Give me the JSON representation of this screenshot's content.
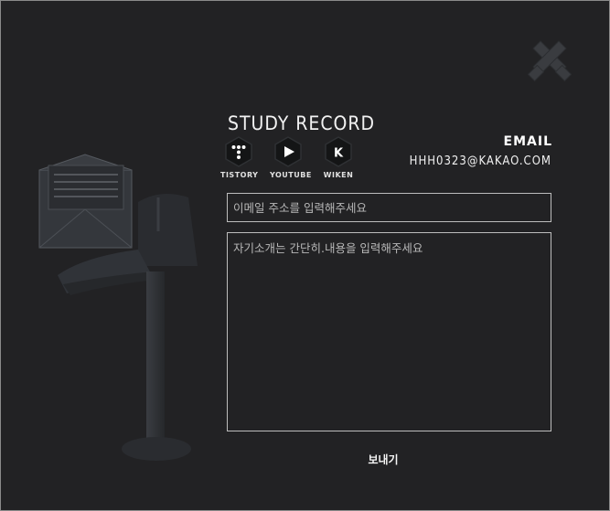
{
  "header": {
    "title": "STUDY RECORD"
  },
  "social_links": [
    {
      "label": "TISTORY",
      "icon": "tistory-icon"
    },
    {
      "label": "YOUTUBE",
      "icon": "youtube-icon"
    },
    {
      "label": "WIKEN",
      "icon": "wiken-icon"
    }
  ],
  "contact": {
    "email_title": "EMAIL",
    "email_value": "HHH0323@KAKAO.COM"
  },
  "form": {
    "email_placeholder": "이메일 주소를 입력해주세요",
    "message_placeholder": "자기소개는 간단히.내용을 입력해주세요",
    "send_label": "보내기"
  },
  "colors": {
    "background": "#222224",
    "border": "#bdbdbd",
    "text": "#e8e8e8"
  }
}
